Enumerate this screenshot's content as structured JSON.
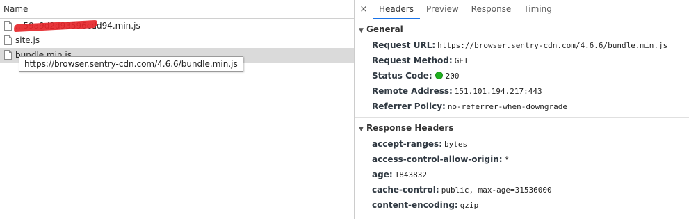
{
  "file_list": {
    "column_header": "Name",
    "files": [
      {
        "name": "...59a9d2d93596cdd94.min.js",
        "redacted": true
      },
      {
        "name": "site.js"
      },
      {
        "name": "bundle.min.js"
      }
    ],
    "tooltip": "https://browser.sentry-cdn.com/4.6.6/bundle.min.js"
  },
  "details": {
    "close_icon": "×",
    "tabs": [
      "Headers",
      "Preview",
      "Response",
      "Timing"
    ],
    "active_tab": "Headers",
    "general": {
      "title": "General",
      "rows": [
        {
          "key": "Request URL:",
          "value": "https://browser.sentry-cdn.com/4.6.6/bundle.min.js"
        },
        {
          "key": "Request Method:",
          "value": "GET"
        },
        {
          "key": "Status Code:",
          "value": "200",
          "status_color": "#1fb11f"
        },
        {
          "key": "Remote Address:",
          "value": "151.101.194.217:443"
        },
        {
          "key": "Referrer Policy:",
          "value": "no-referrer-when-downgrade"
        }
      ]
    },
    "response_headers": {
      "title": "Response Headers",
      "rows": [
        {
          "key": "accept-ranges:",
          "value": "bytes"
        },
        {
          "key": "access-control-allow-origin:",
          "value": "*"
        },
        {
          "key": "age:",
          "value": "1843832"
        },
        {
          "key": "cache-control:",
          "value": "public, max-age=31536000"
        },
        {
          "key": "content-encoding:",
          "value": "gzip"
        }
      ]
    }
  },
  "icons": {
    "file": "file-icon",
    "collapse": "triangle-down-icon",
    "close": "close-icon",
    "status": "status-dot-icon"
  },
  "colors": {
    "accent": "#1a73e8",
    "selected_row": "#dadada",
    "status_ok": "#1fb11f",
    "redaction": "#e5262a"
  }
}
